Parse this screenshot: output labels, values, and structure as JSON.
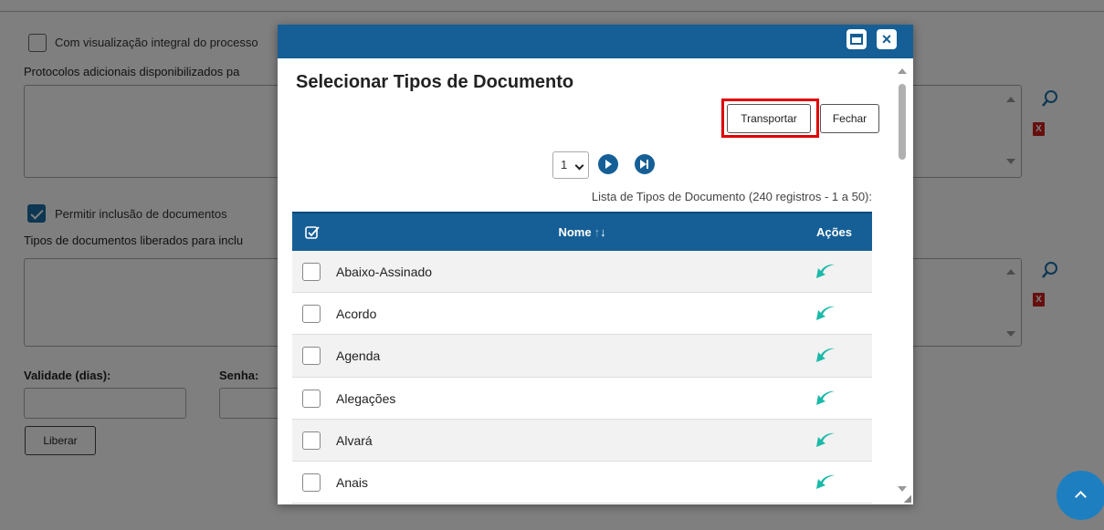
{
  "background": {
    "full_view_label": "Com visualização integral do processo",
    "additional_protocols_label": "Protocolos adicionais disponibilizados pa",
    "allow_docs_label": "Permitir inclusão de documentos",
    "allowed_types_label": "Tipos de documentos liberados para inclu",
    "validity_label": "Validade (dias):",
    "password_label": "Senha:",
    "release_button": "Liberar",
    "remove_icon_text": "X"
  },
  "modal": {
    "title": "Selecionar Tipos de Documento",
    "transport_button": "Transportar",
    "close_button": "Fechar",
    "window_close_glyph": "×",
    "page_select_value": "1",
    "list_caption": "Lista de Tipos de Documento (240 registros - 1 a 50):",
    "columns": {
      "name": "Nome",
      "actions": "Ações"
    },
    "rows": [
      {
        "name": "Abaixo-Assinado"
      },
      {
        "name": "Acordo"
      },
      {
        "name": "Agenda"
      },
      {
        "name": "Alegações"
      },
      {
        "name": "Alvará"
      },
      {
        "name": "Anais"
      }
    ]
  },
  "colors": {
    "brand_blue": "#155f96",
    "action_teal": "#1bb9a8",
    "highlight_red": "#e00000"
  },
  "icons": [
    "search-icon",
    "remove-icon",
    "maximize-icon",
    "close-icon",
    "next-page-icon",
    "last-page-icon",
    "select-all-icon",
    "sort-icon",
    "transport-arrow-icon",
    "scroll-up-icon"
  ]
}
